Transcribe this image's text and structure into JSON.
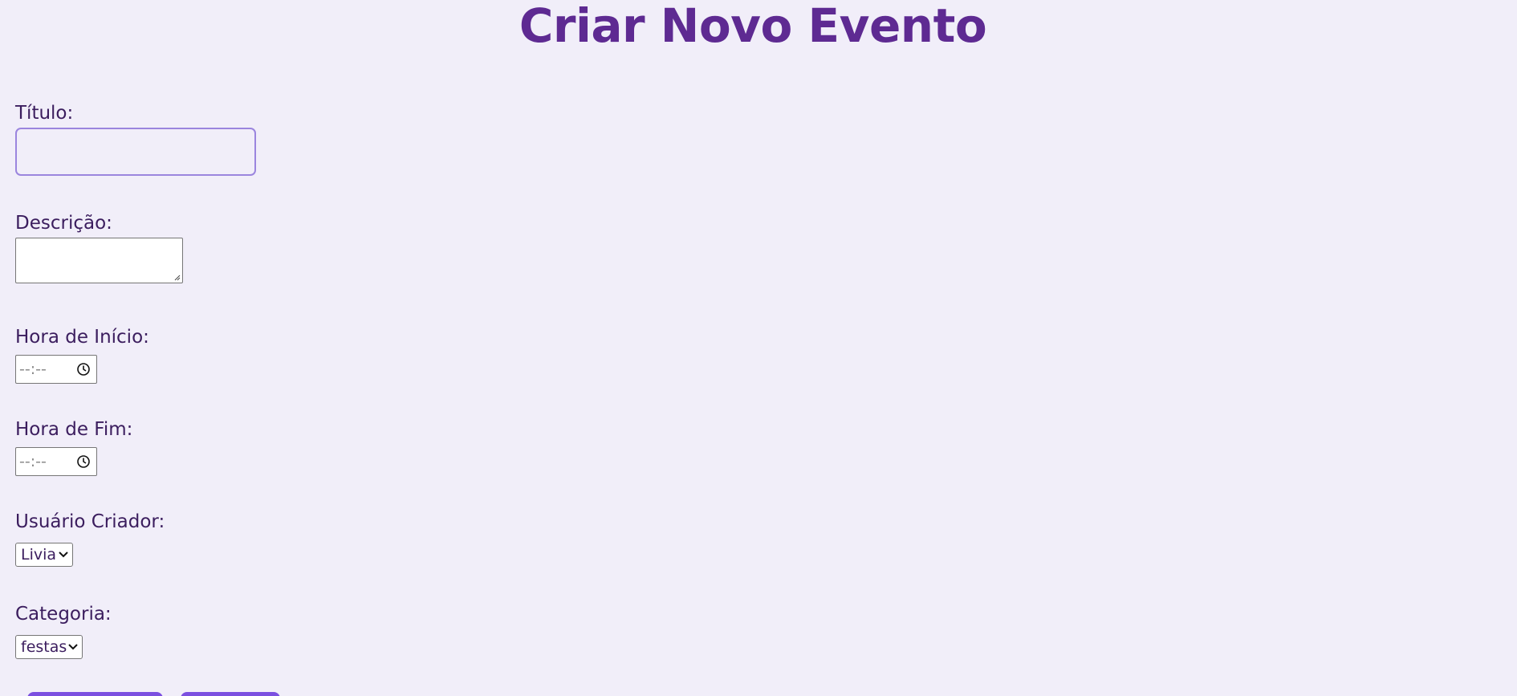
{
  "header": {
    "title": "Criar Novo Evento"
  },
  "form": {
    "titulo_label": "Título:",
    "titulo_value": "",
    "descricao_label": "Descrição:",
    "descricao_value": "",
    "hora_inicio_label": "Hora de Início:",
    "hora_inicio_placeholder": "--:--",
    "hora_fim_label": "Hora de Fim:",
    "hora_fim_placeholder": "--:--",
    "usuario_label": "Usuário Criador:",
    "usuario_selected": "Livia",
    "categoria_label": "Categoria:",
    "categoria_selected": "festas"
  },
  "icons": {
    "time_icon": "clock-icon",
    "select_icon": "chevron-down-icon"
  },
  "colors": {
    "background": "#f1eef9",
    "title": "#5e2a92",
    "label": "#3b1d5e",
    "focus_border": "#9b85de",
    "button": "#7b4fe0"
  }
}
